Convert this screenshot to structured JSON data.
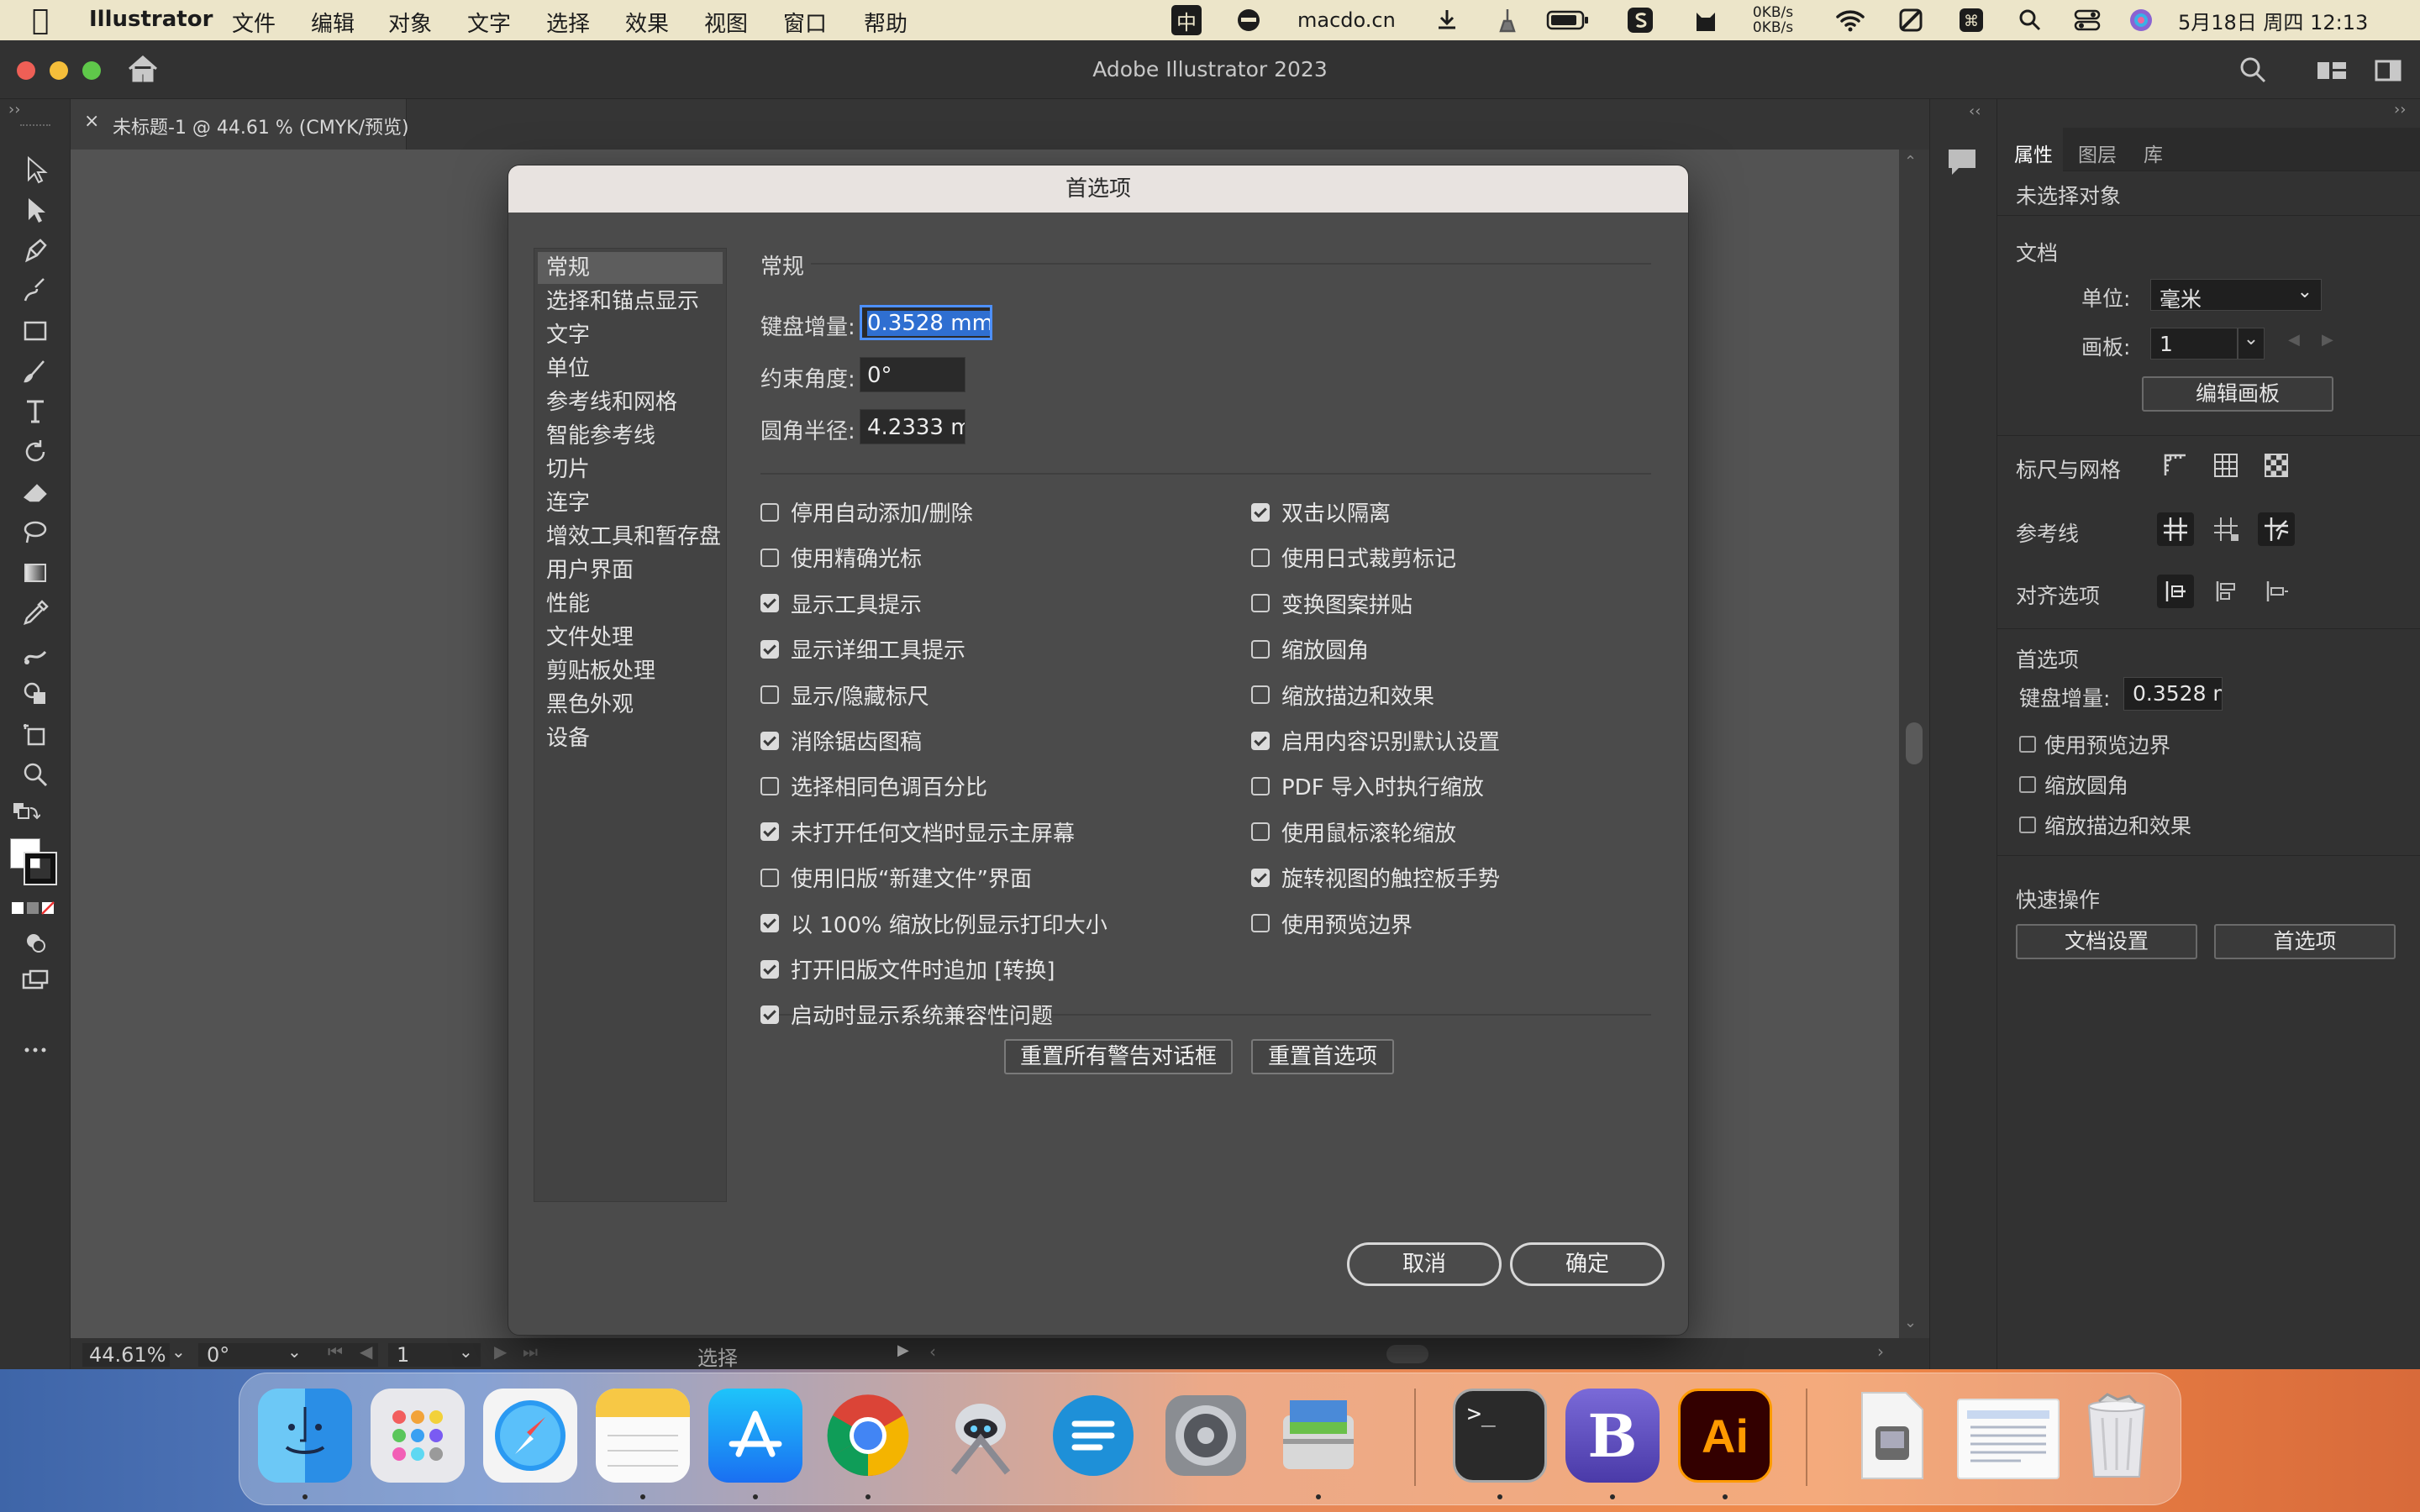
{
  "menubar": {
    "app_name": "Illustrator",
    "items": [
      "文件",
      "编辑",
      "对象",
      "文字",
      "选择",
      "效果",
      "视图",
      "窗口",
      "帮助"
    ],
    "ime": "中",
    "site": "macdo.cn",
    "net_up": "0KB/s",
    "net_down": "0KB/s",
    "datetime": "5月18日 周四  12:13"
  },
  "window": {
    "title": "Adobe Illustrator 2023"
  },
  "doc_tab": {
    "label": "未标题-1 @ 44.61 % (CMYK/预览)",
    "close": "×"
  },
  "status": {
    "zoom": "44.61%",
    "rotate": "0°",
    "artboard": "1",
    "tool": "选择"
  },
  "panel": {
    "tabs": [
      "属性",
      "图层",
      "库"
    ],
    "no_selection": "未选择对象",
    "document_title": "文档",
    "unit_label": "单位:",
    "unit_value": "毫米",
    "artboard_label": "画板:",
    "artboard_value": "1",
    "edit_artboard": "编辑画板",
    "rulers_grid": "标尺与网格",
    "guides": "参考线",
    "align_options": "对齐选项",
    "prefs_title": "首选项",
    "key_increment_label": "键盘增量:",
    "key_increment_value": "0.3528 m",
    "use_preview_bounds": "使用预览边界",
    "scale_corners": "缩放圆角",
    "scale_strokes": "缩放描边和效果",
    "quick_actions": "快速操作",
    "doc_setup_btn": "文档设置",
    "prefs_btn": "首选项"
  },
  "dialog": {
    "title": "首选项",
    "categories": [
      "常规",
      "选择和锚点显示",
      "文字",
      "单位",
      "参考线和网格",
      "智能参考线",
      "切片",
      "连字",
      "增效工具和暂存盘",
      "用户界面",
      "性能",
      "文件处理",
      "剪贴板处理",
      "黑色外观",
      "设备"
    ],
    "section": "常规",
    "key_increment_label": "键盘增量:",
    "key_increment_value": "0.3528 mm",
    "constrain_angle_label": "约束角度:",
    "constrain_angle_value": "0°",
    "corner_radius_label": "圆角半径:",
    "corner_radius_value": "4.2333 m",
    "left_options": [
      {
        "label": "停用自动添加/删除",
        "checked": false
      },
      {
        "label": "使用精确光标",
        "checked": false
      },
      {
        "label": "显示工具提示",
        "checked": true
      },
      {
        "label": "显示详细工具提示",
        "checked": true
      },
      {
        "label": "显示/隐藏标尺",
        "checked": false
      },
      {
        "label": "消除锯齿图稿",
        "checked": true
      },
      {
        "label": "选择相同色调百分比",
        "checked": false
      },
      {
        "label": "未打开任何文档时显示主屏幕",
        "checked": true
      },
      {
        "label": "使用旧版“新建文件”界面",
        "checked": false
      },
      {
        "label": "以 100% 缩放比例显示打印大小",
        "checked": true
      },
      {
        "label": "打开旧版文件时追加 [转换]",
        "checked": true
      },
      {
        "label": "启动时显示系统兼容性问题",
        "checked": true
      }
    ],
    "right_options": [
      {
        "label": "双击以隔离",
        "checked": true
      },
      {
        "label": "使用日式裁剪标记",
        "checked": false
      },
      {
        "label": "变换图案拼贴",
        "checked": false
      },
      {
        "label": "缩放圆角",
        "checked": false
      },
      {
        "label": "缩放描边和效果",
        "checked": false
      },
      {
        "label": "启用内容识别默认设置",
        "checked": true
      },
      {
        "label": "PDF 导入时执行缩放",
        "checked": false
      },
      {
        "label": "使用鼠标滚轮缩放",
        "checked": false
      },
      {
        "label": "旋转视图的触控板手势",
        "checked": true
      },
      {
        "label": "使用预览边界",
        "checked": false
      }
    ],
    "reset_warnings": "重置所有警告对话框",
    "reset_prefs": "重置首选项",
    "cancel": "取消",
    "ok": "确定"
  },
  "dock": {
    "apps": [
      "Finder",
      "Launchpad",
      "Safari",
      "Notes",
      "App Store",
      "Chrome",
      "Automator",
      "Mela",
      "System Preferences",
      "Preview",
      "Terminal",
      "BBEdit",
      "Illustrator",
      "Document",
      "Screenshot",
      "Trash"
    ],
    "ai_label": "Ai",
    "bbedit_label": "B",
    "terminal_label": ">_"
  }
}
